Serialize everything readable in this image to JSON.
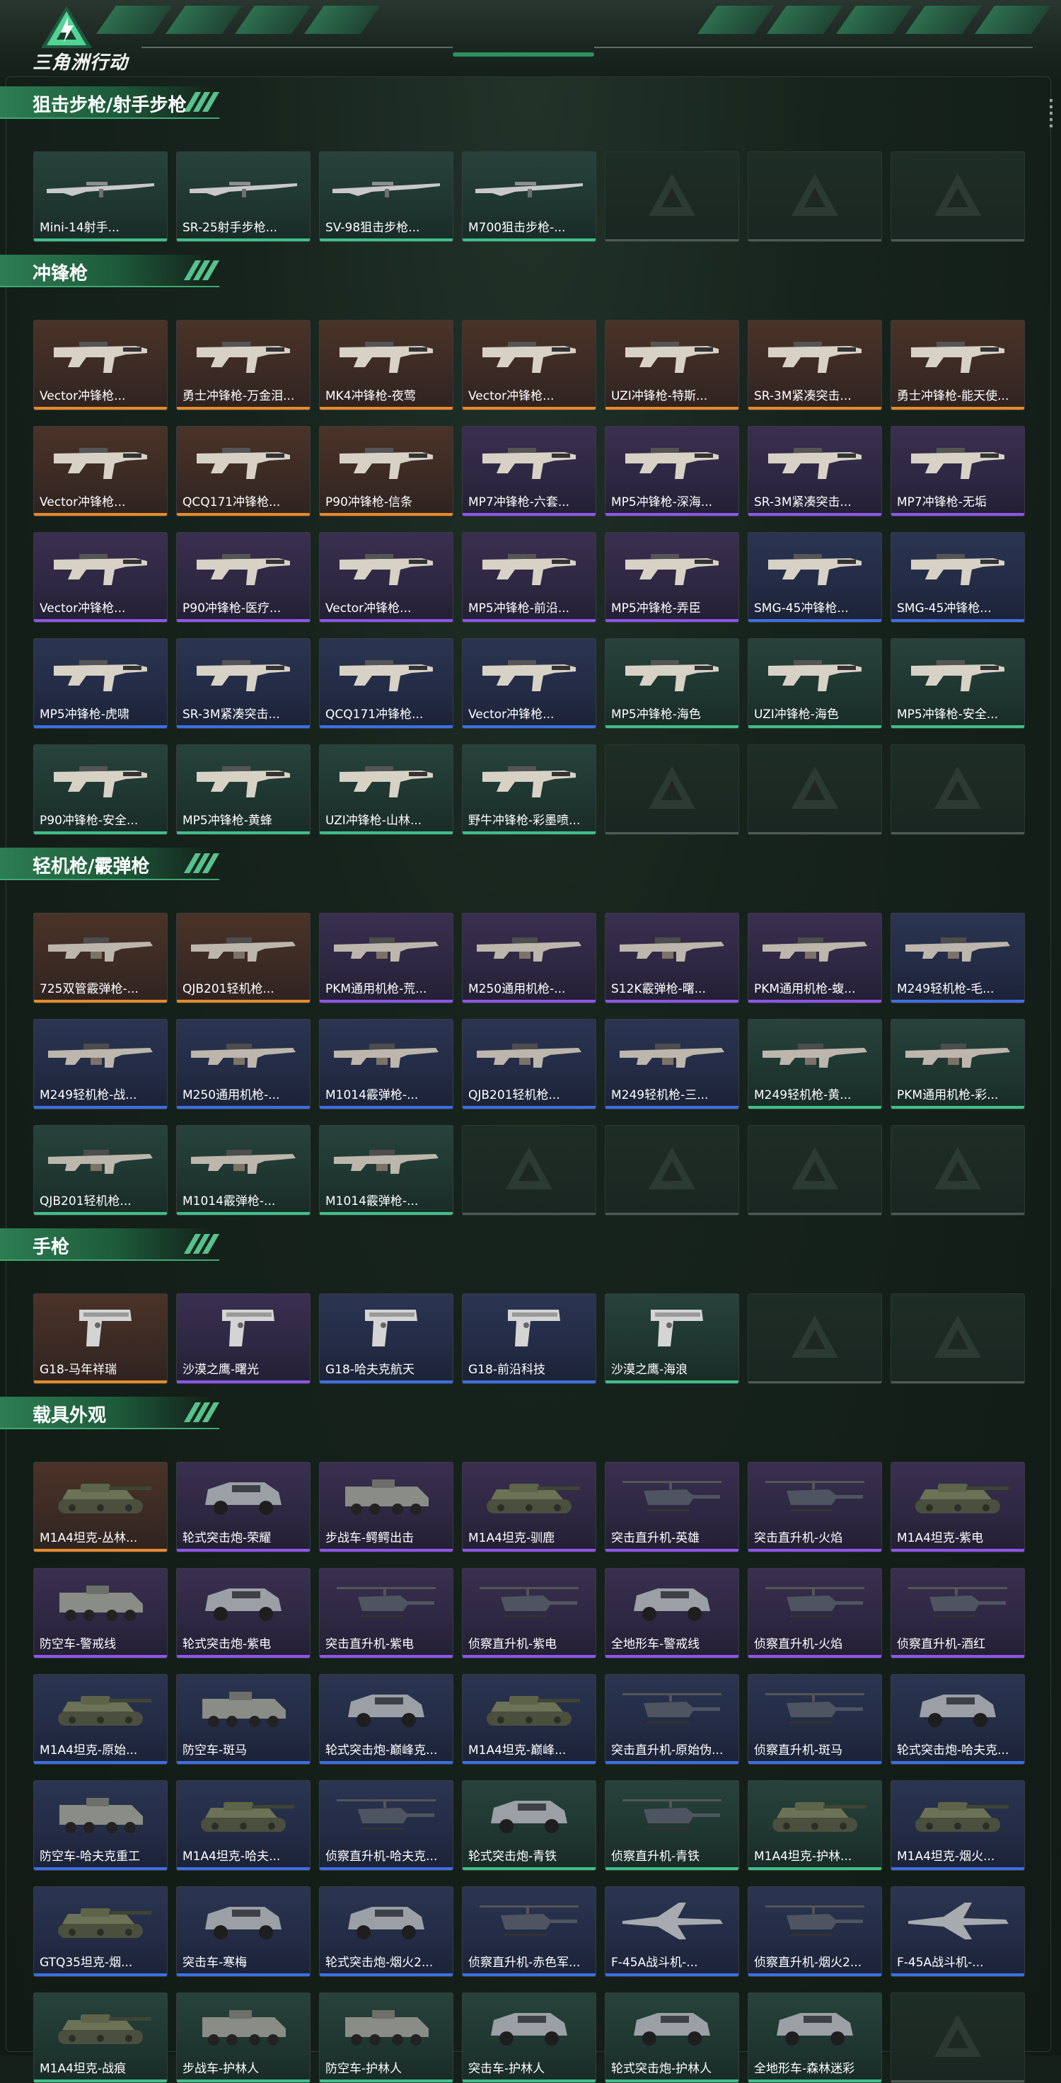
{
  "app": {
    "title": "三角洲行动"
  },
  "sections": [
    {
      "title": "狙击步枪/射手步枪",
      "items": [
        {
          "name": "Mini-14射手...",
          "rarity": "green",
          "kind": "rifle"
        },
        {
          "name": "SR-25射手步枪...",
          "rarity": "green",
          "kind": "rifle"
        },
        {
          "name": "SV-98狙击步枪...",
          "rarity": "green",
          "kind": "rifle"
        },
        {
          "name": "M700狙击步枪-...",
          "rarity": "green",
          "kind": "rifle"
        }
      ],
      "empty_slots": 3
    },
    {
      "title": "冲锋枪",
      "items": [
        {
          "name": "Vector冲锋枪...",
          "rarity": "orange",
          "kind": "smg"
        },
        {
          "name": "勇士冲锋枪-万金泪...",
          "rarity": "orange",
          "kind": "smg"
        },
        {
          "name": "MK4冲锋枪-夜莺",
          "rarity": "orange",
          "kind": "smg"
        },
        {
          "name": "Vector冲锋枪...",
          "rarity": "orange",
          "kind": "smg"
        },
        {
          "name": "UZI冲锋枪-特斯...",
          "rarity": "orange",
          "kind": "smg"
        },
        {
          "name": "SR-3M紧凑突击...",
          "rarity": "orange",
          "kind": "smg"
        },
        {
          "name": "勇士冲锋枪-能天使...",
          "rarity": "orange",
          "kind": "smg"
        },
        {
          "name": "Vector冲锋枪...",
          "rarity": "orange",
          "kind": "smg"
        },
        {
          "name": "QCQ171冲锋枪...",
          "rarity": "orange",
          "kind": "smg"
        },
        {
          "name": "P90冲锋枪-信条",
          "rarity": "orange",
          "kind": "smg"
        },
        {
          "name": "MP7冲锋枪-六套...",
          "rarity": "purple",
          "kind": "smg"
        },
        {
          "name": "MP5冲锋枪-深海...",
          "rarity": "purple",
          "kind": "smg"
        },
        {
          "name": "SR-3M紧凑突击...",
          "rarity": "purple",
          "kind": "smg"
        },
        {
          "name": "MP7冲锋枪-无垢",
          "rarity": "purple",
          "kind": "smg"
        },
        {
          "name": "Vector冲锋枪...",
          "rarity": "purple",
          "kind": "smg"
        },
        {
          "name": "P90冲锋枪-医疗...",
          "rarity": "purple",
          "kind": "smg"
        },
        {
          "name": "Vector冲锋枪...",
          "rarity": "purple",
          "kind": "smg"
        },
        {
          "name": "MP5冲锋枪-前沿...",
          "rarity": "purple",
          "kind": "smg"
        },
        {
          "name": "MP5冲锋枪-弄臣",
          "rarity": "purple",
          "kind": "smg"
        },
        {
          "name": "SMG-45冲锋枪...",
          "rarity": "blue",
          "kind": "smg"
        },
        {
          "name": "SMG-45冲锋枪...",
          "rarity": "blue",
          "kind": "smg"
        },
        {
          "name": "MP5冲锋枪-虎啸",
          "rarity": "blue",
          "kind": "smg"
        },
        {
          "name": "SR-3M紧凑突击...",
          "rarity": "blue",
          "kind": "smg"
        },
        {
          "name": "QCQ171冲锋枪...",
          "rarity": "blue",
          "kind": "smg"
        },
        {
          "name": "Vector冲锋枪...",
          "rarity": "blue",
          "kind": "smg"
        },
        {
          "name": "MP5冲锋枪-海色",
          "rarity": "green",
          "kind": "smg"
        },
        {
          "name": "UZI冲锋枪-海色",
          "rarity": "green",
          "kind": "smg"
        },
        {
          "name": "MP5冲锋枪-安全...",
          "rarity": "green",
          "kind": "smg"
        },
        {
          "name": "P90冲锋枪-安全...",
          "rarity": "green",
          "kind": "smg"
        },
        {
          "name": "MP5冲锋枪-黄蜂",
          "rarity": "green",
          "kind": "smg"
        },
        {
          "name": "UZI冲锋枪-山林...",
          "rarity": "green",
          "kind": "smg"
        },
        {
          "name": "野牛冲锋枪-彩墨喷...",
          "rarity": "green",
          "kind": "smg"
        }
      ],
      "empty_slots": 3
    },
    {
      "title": "轻机枪/霰弹枪",
      "items": [
        {
          "name": "725双管霰弹枪-...",
          "rarity": "orange",
          "kind": "lmg"
        },
        {
          "name": "QJB201轻机枪...",
          "rarity": "orange",
          "kind": "lmg"
        },
        {
          "name": "PKM通用机枪-荒...",
          "rarity": "purple",
          "kind": "lmg"
        },
        {
          "name": "M250通用机枪-...",
          "rarity": "purple",
          "kind": "lmg"
        },
        {
          "name": "S12K霰弹枪-曙...",
          "rarity": "purple",
          "kind": "lmg"
        },
        {
          "name": "PKM通用机枪-蝮...",
          "rarity": "purple",
          "kind": "lmg"
        },
        {
          "name": "M249轻机枪-毛...",
          "rarity": "blue",
          "kind": "lmg"
        },
        {
          "name": "M249轻机枪-战...",
          "rarity": "blue",
          "kind": "lmg"
        },
        {
          "name": "M250通用机枪-...",
          "rarity": "blue",
          "kind": "lmg"
        },
        {
          "name": "M1014霰弹枪-...",
          "rarity": "blue",
          "kind": "lmg"
        },
        {
          "name": "QJB201轻机枪...",
          "rarity": "blue",
          "kind": "lmg"
        },
        {
          "name": "M249轻机枪-三...",
          "rarity": "blue",
          "kind": "lmg"
        },
        {
          "name": "M249轻机枪-黄...",
          "rarity": "green",
          "kind": "lmg"
        },
        {
          "name": "PKM通用机枪-彩...",
          "rarity": "green",
          "kind": "lmg"
        },
        {
          "name": "QJB201轻机枪...",
          "rarity": "green",
          "kind": "lmg"
        },
        {
          "name": "M1014霰弹枪-...",
          "rarity": "green",
          "kind": "lmg"
        },
        {
          "name": "M1014霰弹枪-...",
          "rarity": "green",
          "kind": "lmg"
        }
      ],
      "empty_slots": 4
    },
    {
      "title": "手枪",
      "items": [
        {
          "name": "G18-马年祥瑞",
          "rarity": "orange",
          "kind": "pistol"
        },
        {
          "name": "沙漠之鹰-曙光",
          "rarity": "purple",
          "kind": "pistol"
        },
        {
          "name": "G18-哈夫克航天",
          "rarity": "blue",
          "kind": "pistol"
        },
        {
          "name": "G18-前沿科技",
          "rarity": "blue",
          "kind": "pistol"
        },
        {
          "name": "沙漠之鹰-海浪",
          "rarity": "green",
          "kind": "pistol"
        }
      ],
      "empty_slots": 2
    },
    {
      "title": "载具外观",
      "items": [
        {
          "name": "M1A4坦克-丛林...",
          "rarity": "orange",
          "kind": "tank"
        },
        {
          "name": "轮式突击炮-荣耀",
          "rarity": "purple",
          "kind": "car"
        },
        {
          "name": "步战车-鳄鳄出击",
          "rarity": "purple",
          "kind": "apc"
        },
        {
          "name": "M1A4坦克-驯鹿",
          "rarity": "purple",
          "kind": "tank"
        },
        {
          "name": "突击直升机-英雄",
          "rarity": "purple",
          "kind": "heli"
        },
        {
          "name": "突击直升机-火焰",
          "rarity": "purple",
          "kind": "heli"
        },
        {
          "name": "M1A4坦克-紫电",
          "rarity": "purple",
          "kind": "tank"
        },
        {
          "name": "防空车-警戒线",
          "rarity": "purple",
          "kind": "apc"
        },
        {
          "name": "轮式突击炮-紫电",
          "rarity": "purple",
          "kind": "car"
        },
        {
          "name": "突击直升机-紫电",
          "rarity": "purple",
          "kind": "heli"
        },
        {
          "name": "侦察直升机-紫电",
          "rarity": "purple",
          "kind": "heli"
        },
        {
          "name": "全地形车-警戒线",
          "rarity": "purple",
          "kind": "car"
        },
        {
          "name": "侦察直升机-火焰",
          "rarity": "purple",
          "kind": "heli"
        },
        {
          "name": "侦察直升机-酒红",
          "rarity": "purple",
          "kind": "heli"
        },
        {
          "name": "M1A4坦克-原始...",
          "rarity": "blue",
          "kind": "tank"
        },
        {
          "name": "防空车-斑马",
          "rarity": "blue",
          "kind": "apc"
        },
        {
          "name": "轮式突击炮-巅峰克...",
          "rarity": "blue",
          "kind": "car"
        },
        {
          "name": "M1A4坦克-巅峰...",
          "rarity": "blue",
          "kind": "tank"
        },
        {
          "name": "突击直升机-原始伪...",
          "rarity": "blue",
          "kind": "heli"
        },
        {
          "name": "侦察直升机-斑马",
          "rarity": "blue",
          "kind": "heli"
        },
        {
          "name": "轮式突击炮-哈夫克...",
          "rarity": "blue",
          "kind": "car"
        },
        {
          "name": "防空车-哈夫克重工",
          "rarity": "blue",
          "kind": "apc"
        },
        {
          "name": "M1A4坦克-哈夫...",
          "rarity": "blue",
          "kind": "tank"
        },
        {
          "name": "侦察直升机-哈夫克...",
          "rarity": "blue",
          "kind": "heli"
        },
        {
          "name": "轮式突击炮-青铁",
          "rarity": "green",
          "kind": "car"
        },
        {
          "name": "侦察直升机-青铁",
          "rarity": "green",
          "kind": "heli"
        },
        {
          "name": "M1A4坦克-护林...",
          "rarity": "green",
          "kind": "tank"
        },
        {
          "name": "M1A4坦克-烟火...",
          "rarity": "blue",
          "kind": "tank"
        },
        {
          "name": "GTQ35坦克-烟...",
          "rarity": "blue",
          "kind": "tank"
        },
        {
          "name": "突击车-寒梅",
          "rarity": "blue",
          "kind": "car"
        },
        {
          "name": "轮式突击炮-烟火2...",
          "rarity": "blue",
          "kind": "car"
        },
        {
          "name": "侦察直升机-赤色军...",
          "rarity": "blue",
          "kind": "heli"
        },
        {
          "name": "F-45A战斗机-...",
          "rarity": "blue",
          "kind": "jet"
        },
        {
          "name": "侦察直升机-烟火2...",
          "rarity": "blue",
          "kind": "heli"
        },
        {
          "name": "F-45A战斗机-...",
          "rarity": "blue",
          "kind": "jet"
        },
        {
          "name": "M1A4坦克-战痕",
          "rarity": "green",
          "kind": "tank"
        },
        {
          "name": "步战车-护林人",
          "rarity": "green",
          "kind": "apc"
        },
        {
          "name": "防空车-护林人",
          "rarity": "green",
          "kind": "apc"
        },
        {
          "name": "突击车-护林人",
          "rarity": "green",
          "kind": "car"
        },
        {
          "name": "轮式突击炮-护林人",
          "rarity": "green",
          "kind": "car"
        },
        {
          "name": "全地形车-森林迷彩",
          "rarity": "green",
          "kind": "car"
        }
      ],
      "empty_slots": 1
    }
  ],
  "colors": {
    "orange": "#e48a2a",
    "purple": "#8c56e6",
    "blue": "#3c6fe0",
    "green": "#3fbf86",
    "accent": "#3fa873"
  }
}
